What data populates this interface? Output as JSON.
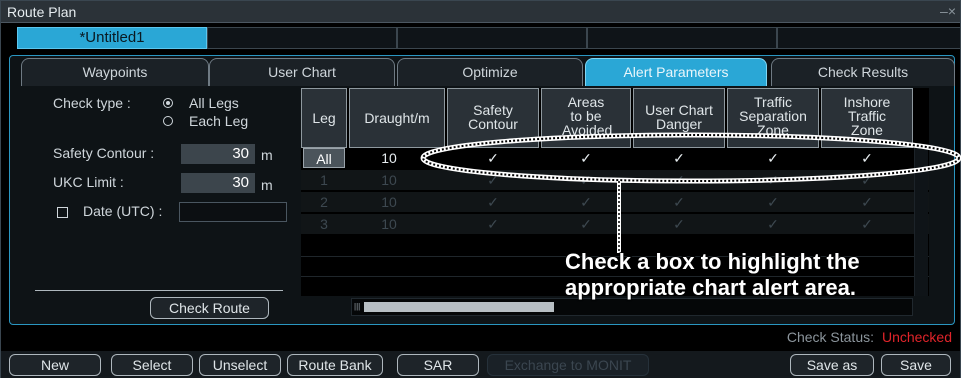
{
  "window": {
    "title": "Route Plan",
    "close_glyph": "–×"
  },
  "file_tab": {
    "label": "*Untitled1"
  },
  "tabs": [
    "Waypoints",
    "User Chart",
    "Optimize",
    "Alert Parameters",
    "Check Results"
  ],
  "active_tab": "Alert Parameters",
  "check_type": {
    "label": "Check type :",
    "options": [
      "All Legs",
      "Each Leg"
    ],
    "selected": "All Legs"
  },
  "safety_contour": {
    "label": "Safety Contour :",
    "value": "30",
    "unit": "m"
  },
  "ukc_limit": {
    "label": "UKC Limit :",
    "value": "30",
    "unit": "m"
  },
  "date_utc": {
    "label": "Date (UTC) :",
    "value": ""
  },
  "check_route_button": "Check Route",
  "table": {
    "headers": [
      "Leg",
      "Draught/m",
      "Safety Contour",
      "Areas to be Avoided",
      "User Chart Danger",
      "Traffic Separation Zone",
      "Inshore Traffic Zone"
    ],
    "rows": [
      {
        "leg": "All",
        "draught": "10",
        "checks": [
          true,
          true,
          true,
          true,
          true
        ]
      },
      {
        "leg": "1",
        "draught": "10",
        "checks": [
          true,
          true,
          true,
          true,
          true
        ]
      },
      {
        "leg": "2",
        "draught": "10",
        "checks": [
          true,
          true,
          true,
          true,
          true
        ]
      },
      {
        "leg": "3",
        "draught": "10",
        "checks": [
          true,
          true,
          true,
          true,
          true
        ]
      }
    ],
    "check_glyph": "✓"
  },
  "status": {
    "label": "Check Status:",
    "value": "Unchecked",
    "value_color": "#e0242a"
  },
  "bottom_buttons": {
    "new": "New",
    "select": "Select",
    "unselect": "Unselect",
    "route_bank": "Route Bank",
    "sar": "SAR",
    "exchange": "Exchange to MONIT",
    "save_as": "Save as",
    "save": "Save"
  },
  "annotation": {
    "text": "Check a box to highlight the appropriate chart alert area."
  },
  "colors": {
    "accent": "#2aa7d6",
    "panel_border": "#2a96c1"
  }
}
